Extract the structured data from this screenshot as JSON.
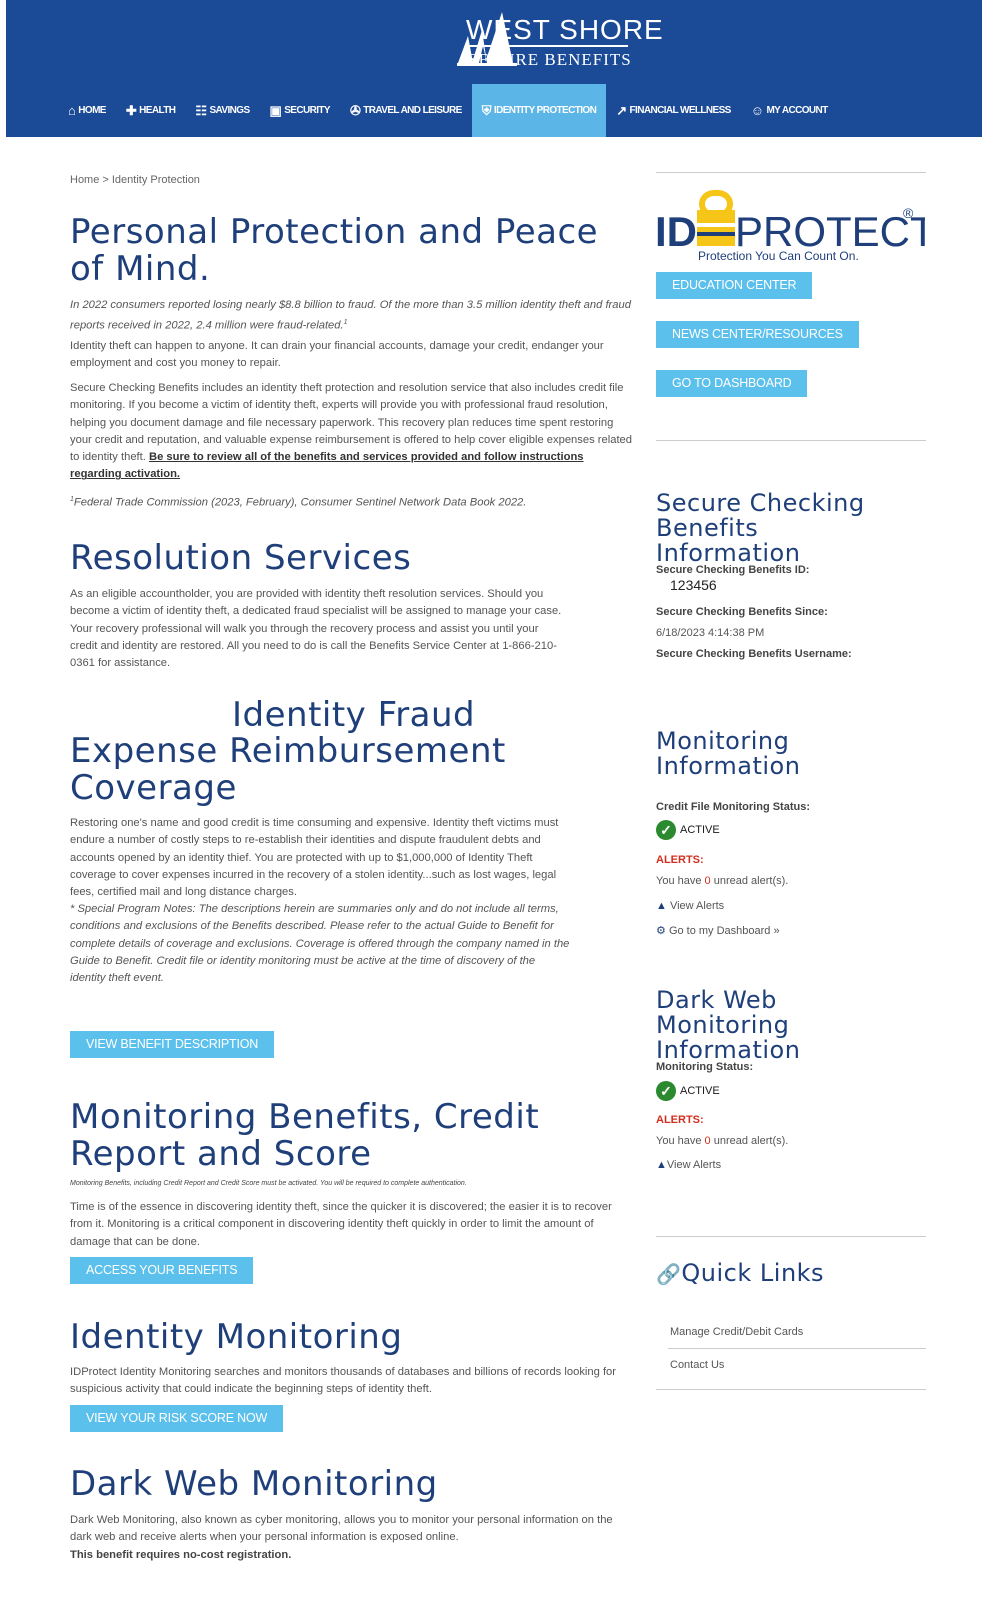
{
  "header": {
    "brand_line1": "WEST SHORE",
    "brand_line2": "SECURE BENEFITS",
    "brand_color": "#1b4a96",
    "active_color": "#5bb5e6"
  },
  "nav": [
    {
      "label": "HOME",
      "icon": "home-icon",
      "glyph": "⌂"
    },
    {
      "label": "HEALTH",
      "icon": "medkit-icon",
      "glyph": "✚"
    },
    {
      "label": "SAVINGS",
      "icon": "cart-icon",
      "glyph": "☷"
    },
    {
      "label": "SECURITY",
      "icon": "lock-icon",
      "glyph": "▣"
    },
    {
      "label": "TRAVEL AND LEISURE",
      "icon": "suitcase-icon",
      "glyph": "✇"
    },
    {
      "label": "IDENTITY PROTECTION",
      "icon": "shield-icon",
      "glyph": "⛨"
    },
    {
      "label": "FINANCIAL WELLNESS",
      "icon": "external-link-icon",
      "glyph": "↗"
    },
    {
      "label": "MY ACCOUNT",
      "icon": "user-icon",
      "glyph": "☺"
    }
  ],
  "breadcrumb": "Home > Identity Protection",
  "main": {
    "title1": "Personal Protection and Peace of Mind.",
    "intro_italic": "In 2022 consumers reported losing nearly $8.8 billion to fraud. Of the more than 3.5 million identity theft and fraud reports received in 2022, 2.4 million were fraud-related.",
    "intro_sup": "1",
    "p1": "Identity theft can happen to anyone. It can drain your financial accounts, damage your credit, endanger your employment and cost you money to repair.",
    "p2": "Secure Checking Benefits includes an identity theft protection and resolution service that also includes credit file monitoring. If you become a victim of identity theft, experts will provide you with professional fraud resolution, helping you document damage and file necessary paperwork. This recovery plan reduces time spent restoring your credit and reputation, and valuable expense reimbursement is offered to help cover eligible expenses related to identity theft.",
    "p2_link": "Be sure to review all of the benefits and services provided and follow instructions regarding activation.",
    "footnote_sup": "1",
    "footnote": "Federal Trade Commission (2023, February), Consumer Sentinel Network Data Book 2022.",
    "title2": "Resolution Services",
    "p3": "As an eligible accountholder, you are provided with identity theft resolution services. Should you become a victim of identity theft, a dedicated fraud specialist will be assigned to manage your case. Your recovery professional will walk you through the recovery process and assist you until your credit and identity are restored. All you need to do is call the Benefits Service Center at 1-866-210-0361 for assistance.",
    "title3_line1": "Identity Fraud",
    "title3_rest": "Expense Reimbursement Coverage",
    "p4": "Restoring one's name and good credit is time consuming and expensive. Identity theft victims must endure a number of costly steps to re-establish their identities and dispute fraudulent debts and accounts opened by an identity thief. You are protected with up to $1,000,000 of Identity Theft coverage to cover expenses incurred in the recovery of a stolen identity...such as lost wages, legal fees, certified mail and long distance charges.",
    "p4_note": "* Special Program Notes: The descriptions herein are summaries only and do not include all terms, conditions and exclusions of the Benefits described. Please refer to the actual Guide to Benefit for complete details of coverage and exclusions. Coverage is offered through the company named in the Guide to Benefit. Credit file or identity monitoring must be active at the time of discovery of the identity theft event.",
    "btn_benefit": "VIEW BENEFIT DESCRIPTION",
    "title4": "Monitoring Benefits, Credit Report and Score",
    "tiny_note": "Monitoring Benefits, including Credit Report and Credit Score must be activated. You will be required to complete authentication.",
    "p5": "Time is of the essence in discovering identity theft, since the quicker it is discovered; the easier it is to recover from it. Monitoring is a critical component in discovering identity theft quickly in order to limit the amount of damage that can be done.",
    "btn_access": "ACCESS YOUR BENEFITS",
    "title5": "Identity Monitoring",
    "p6": "IDProtect Identity Monitoring searches and monitors thousands of databases and billions of records looking for suspicious activity that could indicate the beginning steps of identity theft.",
    "btn_risk": "VIEW YOUR RISK SCORE NOW",
    "title6": "Dark Web Monitoring",
    "p7": "Dark Web Monitoring, also known as cyber monitoring, allows you to monitor your personal information on the dark web and receive alerts when your personal information is exposed online.",
    "p7_bold": "This benefit requires no-cost registration."
  },
  "sidebar": {
    "idprotect_id": "ID",
    "idprotect_protect": "PROTECT",
    "idprotect_reg": "®",
    "idprotect_tagline": "Protection You Can Count On.",
    "btn_education": "EDUCATION CENTER",
    "btn_news": "NEWS CENTER/RESOURCES",
    "btn_dashboard": "GO TO DASHBOARD",
    "scb_title": "Secure Checking Benefits Information",
    "scb_id_label": "Secure Checking Benefits ID:",
    "scb_id_value": "123456",
    "scb_since_label": "Secure Checking Benefits Since:",
    "scb_since_value": "6/18/2023 4:14:38 PM",
    "scb_username_label": "Secure Checking Benefits Username:",
    "mon_title": "Monitoring Information",
    "mon_status_label": "Credit File Monitoring Status:",
    "mon_status": "ACTIVE",
    "mon_alerts": "ALERTS:",
    "mon_you_have": "You have",
    "mon_count": "0",
    "mon_unread": "unread alert(s).",
    "mon_view_alerts": "View Alerts",
    "mon_dashboard": "Go to my Dashboard »",
    "dw_title": "Dark Web Monitoring Information",
    "dw_status_label": "Monitoring Status:",
    "dw_status": "ACTIVE",
    "dw_alerts": "ALERTS:",
    "dw_you_have": "You have",
    "dw_count": "0",
    "dw_unread": "unread alert(s).",
    "dw_view_alerts": "View Alerts",
    "ql_title": "Quick Links",
    "ql_items": [
      "Manage Credit/Debit Cards",
      "Contact Us"
    ]
  }
}
